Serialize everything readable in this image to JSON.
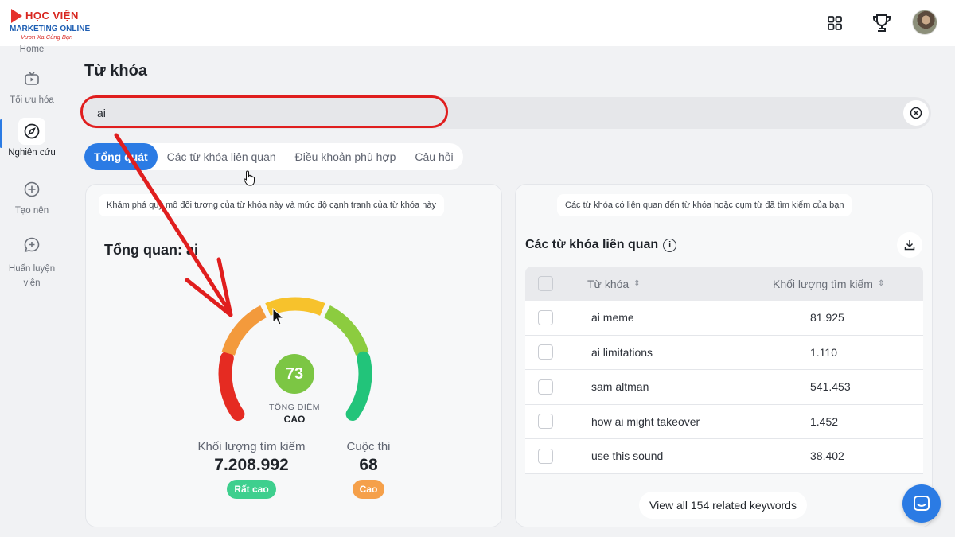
{
  "logo": {
    "line1": "HỌC VIỆN",
    "line2": "MARKETING ONLINE",
    "line3": "Vươn Xa Cùng Bạn"
  },
  "sidebar": {
    "items": [
      {
        "label": "Home",
        "icon": "home-icon"
      },
      {
        "label": "Tối ưu hóa",
        "icon": "video-optimize-icon"
      },
      {
        "label": "Nghiên cứu",
        "icon": "compass-icon"
      },
      {
        "label": "Tạo nên",
        "icon": "plus-circle-icon"
      },
      {
        "label": "Huấn luyện viên",
        "icon": "coach-chat-icon"
      }
    ]
  },
  "page": {
    "title": "Từ khóa"
  },
  "search": {
    "value": "ai",
    "placeholder": ""
  },
  "tabs": [
    {
      "label": "Tổng quát"
    },
    {
      "label": "Các từ khóa liên quan"
    },
    {
      "label": "Điều khoản phù hợp"
    },
    {
      "label": "Câu hỏi"
    }
  ],
  "overview": {
    "note": "Khám phá quy mô đối tượng của từ khóa này và mức độ cạnh tranh của từ khóa này",
    "title": "Tổng quan: ai",
    "score": "73",
    "score_label": "TỔNG ĐIỂM",
    "score_level": "CAO",
    "score_fraction": 0.73,
    "volume_label": "Khối lượng tìm kiếm",
    "volume_value": "7.208.992",
    "volume_badge": "Rất cao",
    "competition_label": "Cuộc thi",
    "competition_value": "68",
    "competition_badge": "Cao"
  },
  "related": {
    "note": "Các từ khóa có liên quan đến từ khóa hoặc cụm từ đã tìm kiếm của bạn",
    "title": "Các từ khóa liên quan",
    "col_keyword": "Từ khóa",
    "col_volume": "Khối lượng tìm kiếm",
    "rows": [
      {
        "keyword": "ai meme",
        "volume": "81.925"
      },
      {
        "keyword": "ai limitations",
        "volume": "1.110"
      },
      {
        "keyword": "sam altman",
        "volume": "541.453"
      },
      {
        "keyword": "how ai might takeover",
        "volume": "1.452"
      },
      {
        "keyword": "use this sound",
        "volume": "38.402"
      }
    ],
    "view_all": "View all 154 related keywords"
  },
  "colors": {
    "accent": "#2b7be4",
    "annotation": "#e01e1e",
    "badge_very_high": "#3ecf8e",
    "badge_high": "#f5a04a"
  }
}
